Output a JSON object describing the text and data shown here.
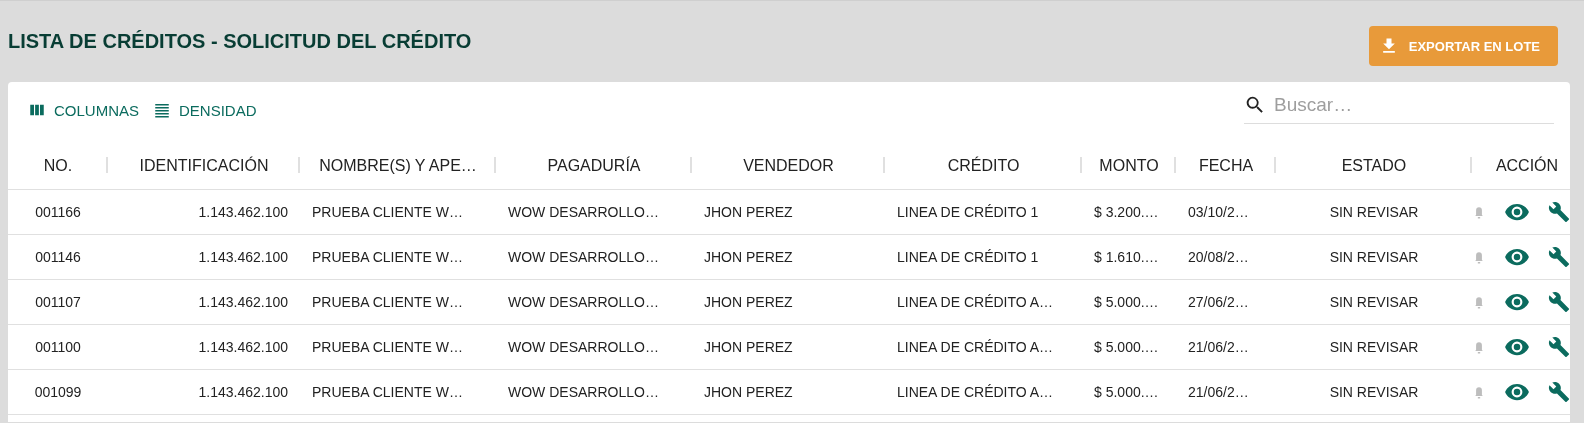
{
  "page": {
    "title": "LISTA DE CRÉDITOS - SOLICITUD DEL CRÉDITO"
  },
  "export_button": {
    "label": "EXPORTAR EN LOTE"
  },
  "toolbar": [
    {
      "kind": "columns",
      "label": "COLUMNAS"
    },
    {
      "kind": "density",
      "label": "DENSIDAD"
    }
  ],
  "search": {
    "placeholder": "Buscar…"
  },
  "table": {
    "columns": [
      "NO.",
      "IDENTIFICACIÓN",
      "NOMBRE(S) Y APE…",
      "PAGADURÍA",
      "VENDEDOR",
      "CRÉDITO",
      "MONTO",
      "FECHA",
      "ESTADO",
      "ACCIÓN"
    ],
    "rows": [
      {
        "cells": [
          "001166",
          "1.143.462.100",
          "PRUEBA CLIENTE W…",
          "WOW DESARROLLO…",
          "JHON PEREZ",
          "LINEA DE CRÉDITO 1",
          "$ 3.200.…",
          "03/10/2…",
          "SIN REVISAR"
        ]
      },
      {
        "cells": [
          "001146",
          "1.143.462.100",
          "PRUEBA CLIENTE W…",
          "WOW DESARROLLO…",
          "JHON PEREZ",
          "LINEA DE CRÉDITO 1",
          "$ 1.610.…",
          "20/08/2…",
          "SIN REVISAR"
        ]
      },
      {
        "cells": [
          "001107",
          "1.143.462.100",
          "PRUEBA CLIENTE W…",
          "WOW DESARROLLO…",
          "JHON PEREZ",
          "LINEA DE CRÉDITO A…",
          "$ 5.000.…",
          "27/06/2…",
          "SIN REVISAR"
        ]
      },
      {
        "cells": [
          "001100",
          "1.143.462.100",
          "PRUEBA CLIENTE W…",
          "WOW DESARROLLO…",
          "JHON PEREZ",
          "LINEA DE CRÉDITO A…",
          "$ 5.000.…",
          "21/06/2…",
          "SIN REVISAR"
        ]
      },
      {
        "cells": [
          "001099",
          "1.143.462.100",
          "PRUEBA CLIENTE W…",
          "WOW DESARROLLO…",
          "JHON PEREZ",
          "LINEA DE CRÉDITO A…",
          "$ 5.000.…",
          "21/06/2…",
          "SIN REVISAR"
        ]
      }
    ]
  }
}
